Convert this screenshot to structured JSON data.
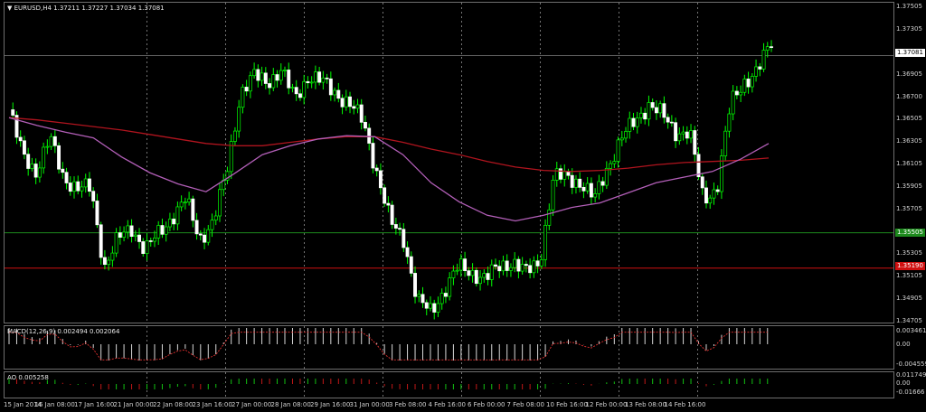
{
  "header": {
    "symbol_title": "EURUSD,H4",
    "ohlc": "1.37211 1.37227 1.37034 1.37081"
  },
  "price_scale": {
    "ticks": [
      "1.37505",
      "1.37305",
      "1.36905",
      "1.36700",
      "1.36505",
      "1.36305",
      "1.36105",
      "1.35905",
      "1.35705",
      "1.35505",
      "1.35305",
      "1.35105",
      "1.34905",
      "1.34705"
    ],
    "current_price": "1.37081",
    "green_level": "1.35505",
    "red_level": "1.35190"
  },
  "macd": {
    "title": "MACD(12,26,9) 0.002494 0.002064",
    "ticks": [
      "0.003461",
      "0.00",
      "-0.004559"
    ]
  },
  "ao": {
    "title": "AO 0.005258",
    "ticks": [
      "0.011749",
      "0.00",
      "-0.01666"
    ]
  },
  "time_axis": [
    "15 Jan 2014",
    "16 Jan 08:00",
    "17 Jan 16:00",
    "21 Jan 00:00",
    "22 Jan 08:00",
    "23 Jan 16:00",
    "27 Jan 00:00",
    "28 Jan 08:00",
    "29 Jan 16:00",
    "31 Jan 00:00",
    "3 Feb 08:00",
    "4 Feb 16:00",
    "6 Feb 00:00",
    "7 Feb 08:00",
    "10 Feb 16:00",
    "12 Feb 00:00",
    "13 Feb 08:00",
    "14 Feb 16:00"
  ],
  "colors": {
    "background": "#000000",
    "bull": "#00ff00",
    "bear": "#ffffff",
    "ma_slow": "#b0141e",
    "ma_fast": "#b35fb8",
    "green_line": "#1d8a1d",
    "red_line": "#d01010",
    "grid": "#c0c0c0",
    "border": "#6e6e6e"
  },
  "chart_data": {
    "type": "candlestick",
    "symbol": "EURUSD",
    "timeframe": "H4",
    "x": [
      "15 Jan 2014",
      "16 Jan 08:00",
      "17 Jan 16:00",
      "21 Jan 00:00",
      "22 Jan 08:00",
      "23 Jan 16:00",
      "27 Jan 00:00",
      "28 Jan 08:00",
      "29 Jan 16:00",
      "31 Jan 00:00",
      "3 Feb 08:00",
      "4 Feb 16:00",
      "6 Feb 00:00",
      "7 Feb 08:00",
      "10 Feb 16:00",
      "12 Feb 00:00",
      "13 Feb 08:00",
      "14 Feb 16:00"
    ],
    "close_path": [
      1.366,
      1.362,
      1.3605,
      1.3635,
      1.36,
      1.359,
      1.359,
      1.352,
      1.3545,
      1.3555,
      1.3535,
      1.355,
      1.3565,
      1.358,
      1.3545,
      1.356,
      1.3605,
      1.3675,
      1.369,
      1.3685,
      1.3695,
      1.367,
      1.369,
      1.3685,
      1.3675,
      1.3665,
      1.365,
      1.3605,
      1.356,
      1.3545,
      1.349,
      1.348,
      1.35,
      1.352,
      1.3515,
      1.351,
      1.352,
      1.3525,
      1.3515,
      1.3525,
      1.36,
      1.36,
      1.3595,
      1.358,
      1.361,
      1.3635,
      1.365,
      1.3665,
      1.3655,
      1.364,
      1.364,
      1.358,
      1.359,
      1.3665,
      1.3685,
      1.3695,
      1.372
    ],
    "indicators": {
      "ma_slow_red": [
        1.3653,
        1.3651,
        1.3648,
        1.3645,
        1.3642,
        1.3638,
        1.3634,
        1.363,
        1.3628,
        1.3628,
        1.3631,
        1.3634,
        1.3636,
        1.3636,
        1.3631,
        1.3625,
        1.362,
        1.3614,
        1.3609,
        1.3606,
        1.3605,
        1.3606,
        1.3608,
        1.3611,
        1.3613,
        1.3614,
        1.3615,
        1.3617
      ],
      "ma_fast_purple": [
        1.3653,
        1.3646,
        1.364,
        1.3635,
        1.3618,
        1.3604,
        1.3594,
        1.3587,
        1.3603,
        1.362,
        1.3628,
        1.3634,
        1.3637,
        1.3636,
        1.362,
        1.3595,
        1.3578,
        1.3566,
        1.3561,
        1.3566,
        1.3573,
        1.3577,
        1.3586,
        1.3595,
        1.36,
        1.3605,
        1.3616,
        1.363
      ]
    },
    "horizontal_levels": [
      1.35505,
      1.3519,
      1.37081
    ],
    "ylim": [
      1.346,
      1.376
    ]
  }
}
